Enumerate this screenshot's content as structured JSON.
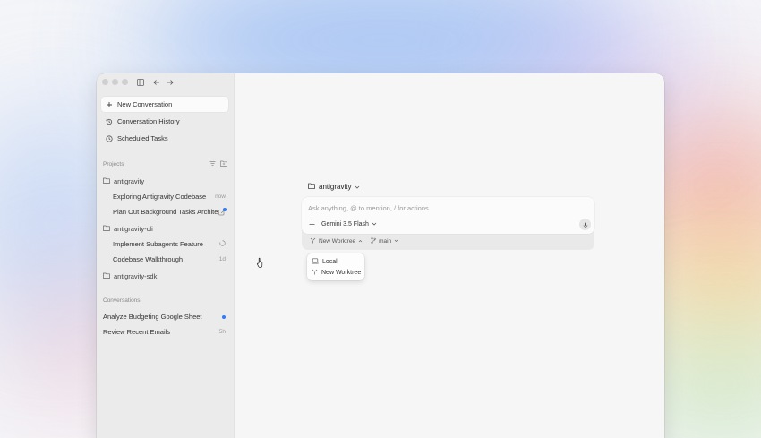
{
  "sidebar": {
    "nav": [
      {
        "label": "New Conversation",
        "icon": "plus-icon"
      },
      {
        "label": "Conversation History",
        "icon": "history-icon"
      },
      {
        "label": "Scheduled Tasks",
        "icon": "clock-icon"
      }
    ],
    "projects_title": "Projects",
    "projects": [
      {
        "name": "antigravity",
        "conversations": [
          {
            "title": "Exploring Antigravity Codebase",
            "meta": "now"
          },
          {
            "title": "Plan Out Background Tasks Archite...",
            "meta": ""
          }
        ]
      },
      {
        "name": "antigravity-cli",
        "conversations": [
          {
            "title": "Implement Subagents Feature",
            "meta": ""
          },
          {
            "title": "Codebase Walkthrough",
            "meta": "1d"
          }
        ]
      },
      {
        "name": "antigravity-sdk",
        "conversations": []
      }
    ],
    "conversations_title": "Conversations",
    "conversations": [
      {
        "title": "Analyze Budgeting Google Sheet",
        "meta": ""
      },
      {
        "title": "Review Recent Emails",
        "meta": "5h"
      }
    ]
  },
  "main": {
    "project_selector": "antigravity",
    "composer": {
      "placeholder": "Ask anything, @ to mention, / for actions",
      "model": "Gemini 3.5 Flash",
      "worktree": "New Worktree",
      "branch": "main"
    },
    "dropdown": [
      {
        "label": "Local",
        "icon": "laptop-icon"
      },
      {
        "label": "New Worktree",
        "icon": "worktree-icon"
      }
    ]
  },
  "colors": {
    "accent": "#2f7cf6"
  }
}
